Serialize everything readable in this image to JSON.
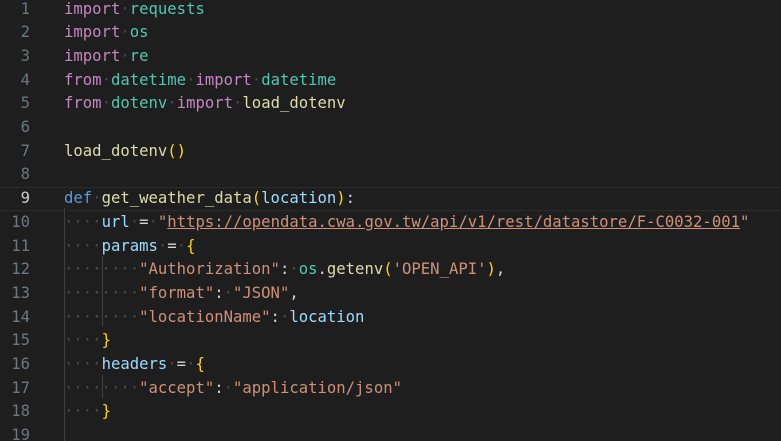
{
  "editor": {
    "colors": {
      "background": "#1e1e1e",
      "keyword": "#c586c0",
      "def_keyword": "#569cd6",
      "module": "#4ec9b0",
      "function": "#dcdcaa",
      "variable": "#9cdcfe",
      "string": "#ce9178",
      "bracket": "#ffd700",
      "line_number": "#6e7681"
    },
    "current_line": "9",
    "lines": [
      {
        "num": "1",
        "code": [
          {
            "t": "import",
            "c": "kw"
          },
          {
            "t": "·",
            "c": "ws"
          },
          {
            "t": "requests",
            "c": "mod"
          }
        ]
      },
      {
        "num": "2",
        "code": [
          {
            "t": "import",
            "c": "kw"
          },
          {
            "t": "·",
            "c": "ws"
          },
          {
            "t": "os",
            "c": "mod"
          }
        ]
      },
      {
        "num": "3",
        "code": [
          {
            "t": "import",
            "c": "kw"
          },
          {
            "t": "·",
            "c": "ws"
          },
          {
            "t": "re",
            "c": "mod"
          }
        ]
      },
      {
        "num": "4",
        "code": [
          {
            "t": "from",
            "c": "kw"
          },
          {
            "t": "·",
            "c": "ws"
          },
          {
            "t": "datetime",
            "c": "mod"
          },
          {
            "t": "·",
            "c": "ws"
          },
          {
            "t": "import",
            "c": "kw"
          },
          {
            "t": "·",
            "c": "ws"
          },
          {
            "t": "datetime",
            "c": "mod"
          }
        ]
      },
      {
        "num": "5",
        "code": [
          {
            "t": "from",
            "c": "kw"
          },
          {
            "t": "·",
            "c": "ws"
          },
          {
            "t": "dotenv",
            "c": "mod"
          },
          {
            "t": "·",
            "c": "ws"
          },
          {
            "t": "import",
            "c": "kw"
          },
          {
            "t": "·",
            "c": "ws"
          },
          {
            "t": "load_dotenv",
            "c": "fn"
          }
        ]
      },
      {
        "num": "6",
        "code": []
      },
      {
        "num": "7",
        "code": [
          {
            "t": "load_dotenv",
            "c": "fn"
          },
          {
            "t": "()",
            "c": "paren"
          }
        ]
      },
      {
        "num": "8",
        "code": []
      },
      {
        "num": "9",
        "code": [
          {
            "t": "def",
            "c": "kw-def"
          },
          {
            "t": "·",
            "c": "ws"
          },
          {
            "t": "get_weather_data",
            "c": "fn"
          },
          {
            "t": "(",
            "c": "paren"
          },
          {
            "t": "location",
            "c": "var"
          },
          {
            "t": ")",
            "c": "paren"
          },
          {
            "t": ":",
            "c": "op"
          }
        ]
      },
      {
        "num": "10",
        "code": [
          {
            "t": "····",
            "c": "ws"
          },
          {
            "t": "url",
            "c": "var"
          },
          {
            "t": "·",
            "c": "ws"
          },
          {
            "t": "=",
            "c": "op"
          },
          {
            "t": "·",
            "c": "ws"
          },
          {
            "t": "\"",
            "c": "str"
          },
          {
            "t": "https://opendata.cwa.gov.tw/api/v1/rest/datastore/F-C0032-001",
            "c": "url"
          },
          {
            "t": "\"",
            "c": "str"
          }
        ]
      },
      {
        "num": "11",
        "code": [
          {
            "t": "····",
            "c": "ws"
          },
          {
            "t": "params",
            "c": "var"
          },
          {
            "t": "·",
            "c": "ws"
          },
          {
            "t": "=",
            "c": "op"
          },
          {
            "t": "·",
            "c": "ws"
          },
          {
            "t": "{",
            "c": "brace"
          }
        ]
      },
      {
        "num": "12",
        "code": [
          {
            "t": "········",
            "c": "ws"
          },
          {
            "t": "\"Authorization\"",
            "c": "str"
          },
          {
            "t": ":",
            "c": "op"
          },
          {
            "t": "·",
            "c": "ws"
          },
          {
            "t": "os",
            "c": "mod"
          },
          {
            "t": ".",
            "c": "op"
          },
          {
            "t": "getenv",
            "c": "fn"
          },
          {
            "t": "(",
            "c": "paren"
          },
          {
            "t": "'OPEN_API'",
            "c": "str"
          },
          {
            "t": ")",
            "c": "paren"
          },
          {
            "t": ",",
            "c": "op"
          }
        ]
      },
      {
        "num": "13",
        "code": [
          {
            "t": "········",
            "c": "ws"
          },
          {
            "t": "\"format\"",
            "c": "str"
          },
          {
            "t": ":",
            "c": "op"
          },
          {
            "t": "·",
            "c": "ws"
          },
          {
            "t": "\"JSON\"",
            "c": "str"
          },
          {
            "t": ",",
            "c": "op"
          }
        ]
      },
      {
        "num": "14",
        "code": [
          {
            "t": "········",
            "c": "ws"
          },
          {
            "t": "\"locationName\"",
            "c": "str"
          },
          {
            "t": ":",
            "c": "op"
          },
          {
            "t": "·",
            "c": "ws"
          },
          {
            "t": "location",
            "c": "var"
          }
        ]
      },
      {
        "num": "15",
        "code": [
          {
            "t": "····",
            "c": "ws"
          },
          {
            "t": "}",
            "c": "brace"
          }
        ]
      },
      {
        "num": "16",
        "code": [
          {
            "t": "····",
            "c": "ws"
          },
          {
            "t": "headers",
            "c": "var"
          },
          {
            "t": "·",
            "c": "ws"
          },
          {
            "t": "=",
            "c": "op"
          },
          {
            "t": "·",
            "c": "ws"
          },
          {
            "t": "{",
            "c": "brace"
          }
        ]
      },
      {
        "num": "17",
        "code": [
          {
            "t": "········",
            "c": "ws"
          },
          {
            "t": "\"accept\"",
            "c": "str"
          },
          {
            "t": ":",
            "c": "op"
          },
          {
            "t": "·",
            "c": "ws"
          },
          {
            "t": "\"application/json\"",
            "c": "str"
          }
        ]
      },
      {
        "num": "18",
        "code": [
          {
            "t": "····",
            "c": "ws"
          },
          {
            "t": "}",
            "c": "brace"
          }
        ]
      },
      {
        "num": "19",
        "code": []
      }
    ]
  }
}
